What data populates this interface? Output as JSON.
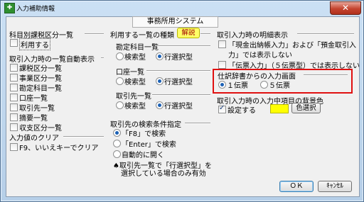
{
  "window": {
    "title": "入力補助情報",
    "close_label": "✕"
  },
  "header": {
    "system_name": "事務所用システム"
  },
  "left": {
    "account_classification": {
      "title": "科目別課税区分一覧",
      "use_label": "利用する",
      "use_checked": false
    },
    "auto_display": {
      "title": "取引入力時の一覧自動表示",
      "items": [
        {
          "label": "課税区分一覧",
          "checked": false
        },
        {
          "label": "事業区分一覧",
          "checked": false
        },
        {
          "label": "勘定科目一覧",
          "checked": false
        },
        {
          "label": "口座一覧",
          "checked": false
        },
        {
          "label": "取引先一覧",
          "checked": false
        },
        {
          "label": "摘要一覧",
          "checked": false
        },
        {
          "label": "収支区分一覧",
          "checked": false
        }
      ]
    },
    "input_clear": {
      "title": "入力値のクリア",
      "f9_label": "F9、いいえキーでクリア",
      "f9_checked": false
    }
  },
  "middle": {
    "list_type": {
      "title": "利用する一覧の種類",
      "help_label": "解説",
      "groups": [
        {
          "title": "勘定科目一覧",
          "options": [
            "検索型",
            "行選択型"
          ],
          "selected": 1
        },
        {
          "title": "口座一覧",
          "options": [
            "検索型",
            "行選択型"
          ],
          "selected": 1
        },
        {
          "title": "取引先一覧",
          "options": [
            "検索型",
            "行選択型"
          ],
          "selected": 1
        }
      ]
    },
    "partner_search": {
      "title": "取引先の検索条件指定",
      "options": [
        "「F8」で検索",
        "「Enter」で検索",
        "自動的に開く"
      ],
      "selected": 0,
      "note_line1": "♠取引先一覧で「行選択型」を",
      "note_line2": "選択している場合のみ有効"
    }
  },
  "right": {
    "detail_display": {
      "title": "取引入力時の明細表示",
      "item1_line1": "「現金出納帳入力」および「預金取引入",
      "item1_line2": "力」では表示しない",
      "item1_checked": false,
      "item2_label": "「伝票入力」（５伝票型）では表示しない",
      "item2_checked": false
    },
    "journal_input": {
      "title": "仕訳辞書からの入力画面",
      "options": [
        "１伝票",
        "５伝票"
      ],
      "selected": 0
    },
    "bg_color": {
      "title": "取引入力時の入力中項目の背景色",
      "set_label": "設定する",
      "set_checked": true,
      "color": "#ffff00",
      "select_label": "色選択"
    },
    "highlight_color": "#e01010"
  },
  "footer": {
    "ok_label": "ＯＫ",
    "cancel_label": "ｷｬﾝｾﾙ"
  }
}
